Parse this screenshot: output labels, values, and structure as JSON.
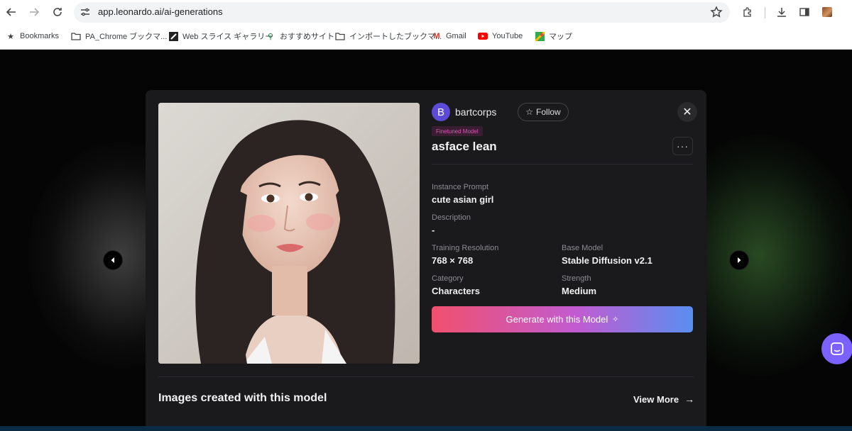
{
  "browser": {
    "url": "app.leonardo.ai/ai-generations",
    "bookmarks": [
      {
        "label": "Bookmarks",
        "icon": "star-icon"
      },
      {
        "label": "PA_Chrome ブックマ...",
        "icon": "folder-icon"
      },
      {
        "label": "Web スライス ギャラリー",
        "icon": "web-slice-icon"
      },
      {
        "label": "おすすめサイト",
        "icon": "search-icon"
      },
      {
        "label": "インポートしたブックマ...",
        "icon": "folder-icon"
      },
      {
        "label": "Gmail",
        "icon": "gmail-icon"
      },
      {
        "label": "YouTube",
        "icon": "youtube-icon"
      },
      {
        "label": "マップ",
        "icon": "maps-icon"
      }
    ]
  },
  "modal": {
    "user": {
      "initial": "B",
      "name": "bartcorps",
      "follow_label": "Follow"
    },
    "tag": "Finetuned Model",
    "model_name": "asface lean",
    "more_label": "···",
    "fields": {
      "instance_prompt_label": "Instance Prompt",
      "instance_prompt": "cute asian girl",
      "description_label": "Description",
      "description": "-",
      "training_resolution_label": "Training Resolution",
      "training_resolution": "768 × 768",
      "base_model_label": "Base Model",
      "base_model": "Stable Diffusion v2.1",
      "category_label": "Category",
      "category": "Characters",
      "strength_label": "Strength",
      "strength": "Medium"
    },
    "generate_label": "Generate with this Model",
    "images_section_title": "Images created with this model",
    "view_more_label": "View More"
  },
  "colors": {
    "accent_purple": "#5b4bd6",
    "tag_pink": "#d45ab0",
    "generate_gradient_start": "#f0506e",
    "generate_gradient_end": "#5a8ef0",
    "chat_button": "#7b61ff"
  }
}
